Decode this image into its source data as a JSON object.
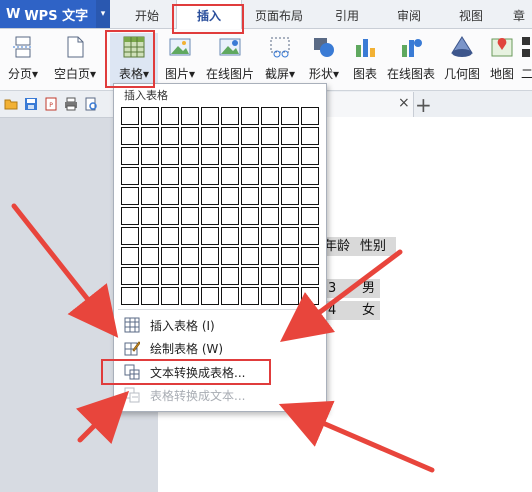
{
  "app": {
    "name": "WPS 文字",
    "logo": "W"
  },
  "tabs": [
    {
      "label": "开始",
      "active": false
    },
    {
      "label": "插入",
      "active": true
    },
    {
      "label": "页面布局",
      "active": false
    },
    {
      "label": "引用",
      "active": false
    },
    {
      "label": "审阅",
      "active": false
    },
    {
      "label": "视图",
      "active": false
    },
    {
      "label": "章",
      "active": false
    }
  ],
  "ribbon": {
    "items": [
      {
        "label": "分页",
        "icon": "page-break-icon",
        "dropdown": true
      },
      {
        "label": "空白页",
        "icon": "blank-page-icon",
        "dropdown": true
      },
      {
        "label": "表格",
        "icon": "table-icon",
        "dropdown": true
      },
      {
        "label": "图片",
        "icon": "picture-icon",
        "dropdown": true
      },
      {
        "label": "在线图片",
        "icon": "online-picture-icon",
        "dropdown": false
      },
      {
        "label": "截屏",
        "icon": "screenshot-icon",
        "dropdown": true
      },
      {
        "label": "形状",
        "icon": "shapes-icon",
        "dropdown": true
      },
      {
        "label": "图表",
        "icon": "chart-icon",
        "dropdown": false
      },
      {
        "label": "在线图表",
        "icon": "online-chart-icon",
        "dropdown": false
      },
      {
        "label": "几何图",
        "icon": "geometry-icon",
        "dropdown": false
      },
      {
        "label": "地图",
        "icon": "map-icon",
        "dropdown": false
      },
      {
        "label": "二",
        "icon": "qrcode-icon",
        "dropdown": false
      }
    ],
    "dropdown_arrow": "▾"
  },
  "doc_tab": {
    "close": "×",
    "new_tab": "+"
  },
  "document": {
    "rows": [
      [
        "年龄",
        "性别"
      ],
      [
        "3",
        "男"
      ],
      [
        "4",
        "女"
      ]
    ]
  },
  "table_menu": {
    "title": "插入表格",
    "grid": {
      "rows": 10,
      "cols": 10
    },
    "items": [
      {
        "label": "插入表格 (I)",
        "icon": "insert-table-icon",
        "enabled": true
      },
      {
        "label": "绘制表格 (W)",
        "icon": "draw-table-icon",
        "enabled": true
      },
      {
        "label": "文本转换成表格...",
        "icon": "text-to-table-icon",
        "enabled": true
      },
      {
        "label": "表格转换成文本...",
        "icon": "table-to-text-icon",
        "enabled": false
      }
    ]
  },
  "colors": {
    "accent": "#2f63c6",
    "highlight": "#e03c3c",
    "arrow": "#e8453c"
  }
}
